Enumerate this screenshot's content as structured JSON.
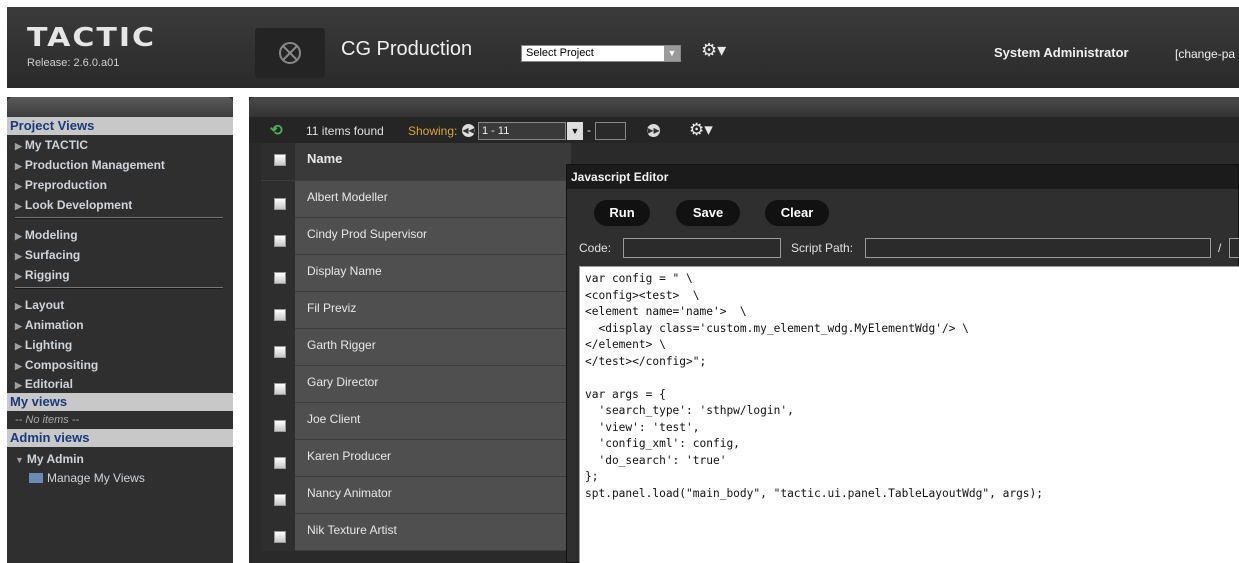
{
  "header": {
    "logo": "TACTIC",
    "release": "Release: 2.6.0.a01",
    "project_title": "CG Production",
    "project_select": "Select Project",
    "user_name": "System Administrator",
    "change_password": "[change-pa"
  },
  "sidebar": {
    "project_views_title": "Project Views",
    "group1": [
      "My TACTIC",
      "Production Management",
      "Preproduction",
      "Look Development"
    ],
    "group2": [
      "Modeling",
      "Surfacing",
      "Rigging"
    ],
    "group3": [
      "Layout",
      "Animation",
      "Lighting",
      "Compositing",
      "Editorial"
    ],
    "my_views_title": "My views",
    "no_items": "-- No items --",
    "admin_views_title": "Admin views",
    "my_admin": "My Admin",
    "manage_views": "Manage My Views"
  },
  "toolbar": {
    "items_found": "11 items found",
    "showing_label": "Showing:",
    "range": "1 - 11",
    "dash": "-"
  },
  "table": {
    "header": "Name",
    "rows": [
      "Albert Modeller",
      "Cindy Prod Supervisor",
      "Display Name",
      "Fil Previz",
      "Garth Rigger",
      "Gary Director",
      "Joe Client",
      "Karen Producer",
      "Nancy Animator",
      "Nik Texture Artist"
    ]
  },
  "editor": {
    "title": "Javascript Editor",
    "run": "Run",
    "save": "Save",
    "clear": "Clear",
    "code_label": "Code:",
    "path_label": "Script Path:",
    "slash": "/",
    "code": "var config = \" \\\n<config><test>  \\\n<element name='name'>  \\\n  <display class='custom.my_element_wdg.MyElementWdg'/> \\\n</element> \\\n</test></config>\";\n\nvar args = {\n  'search_type': 'sthpw/login',\n  'view': 'test',\n  'config_xml': config,\n  'do_search': 'true'\n};\nspt.panel.load(\"main_body\", \"tactic.ui.panel.TableLayoutWdg\", args);"
  }
}
